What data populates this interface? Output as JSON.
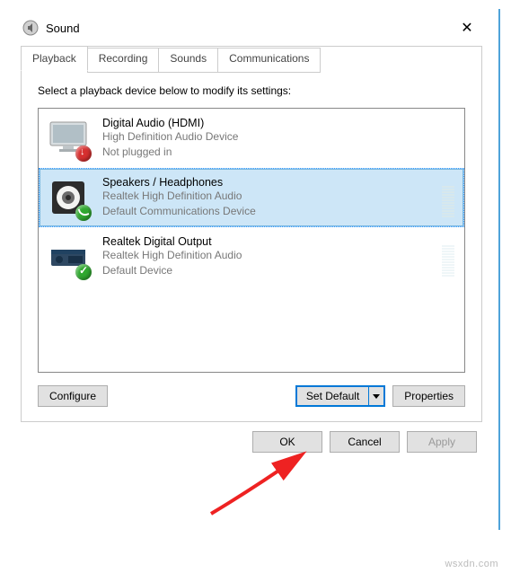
{
  "window": {
    "title": "Sound",
    "close": "✕"
  },
  "tabs": {
    "playback": "Playback",
    "recording": "Recording",
    "sounds": "Sounds",
    "communications": "Communications"
  },
  "prompt": "Select a playback device below to modify its settings:",
  "devices": [
    {
      "name": "Digital Audio (HDMI)",
      "line1": "High Definition Audio Device",
      "line2": "Not plugged in"
    },
    {
      "name": "Speakers / Headphones",
      "line1": "Realtek High Definition Audio",
      "line2": "Default Communications Device"
    },
    {
      "name": "Realtek Digital Output",
      "line1": "Realtek High Definition Audio",
      "line2": "Default Device"
    }
  ],
  "buttons": {
    "configure": "Configure",
    "set_default": "Set Default",
    "properties": "Properties",
    "ok": "OK",
    "cancel": "Cancel",
    "apply": "Apply"
  },
  "watermark": "wsxdn.com"
}
